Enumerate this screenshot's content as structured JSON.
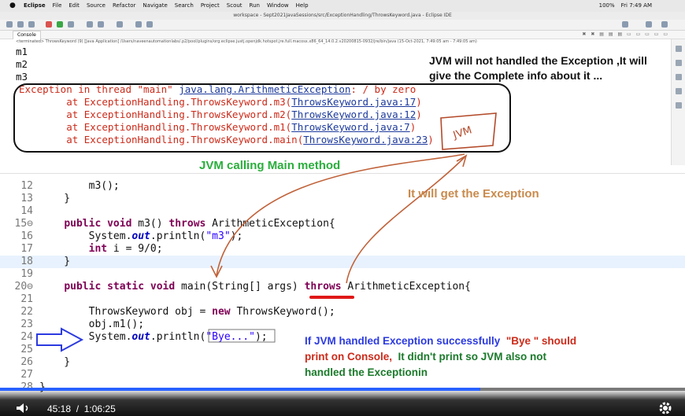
{
  "menubar": {
    "items": [
      "Eclipse",
      "File",
      "Edit",
      "Source",
      "Refactor",
      "Navigate",
      "Search",
      "Project",
      "Scout",
      "Run",
      "Window",
      "Help"
    ],
    "battery": "100%",
    "clock": "Fri 7:49 AM"
  },
  "window": {
    "title": "workspace - Sept2021JavaSessions/src/ExceptionHandling/ThrowsKeyword.java - Eclipse IDE"
  },
  "console": {
    "tab_label": "Console",
    "terminated_line": "<terminated> ThrowsKeyword (9) [Java Application] /Users/naveenautomationlabs/.p2/pool/plugins/org.eclipse.justj.openjdk.hotspot.jre.full.macosx.x86_64_14.0.2.v20200815-0932/jre/bin/java (15-Oct-2021, 7:49:05 am - 7:49:05 am)",
    "output": [
      "m1",
      "m2",
      "m3"
    ],
    "exception": {
      "prefix": "Exception in thread \"main\" ",
      "class": "java.lang.ArithmeticException",
      "suffix": ": / by zero"
    },
    "stack": [
      {
        "at": "        at ExceptionHandling.ThrowsKeyword.m3(",
        "link": "ThrowsKeyword.java:17",
        "end": ")"
      },
      {
        "at": "        at ExceptionHandling.ThrowsKeyword.m2(",
        "link": "ThrowsKeyword.java:12",
        "end": ")"
      },
      {
        "at": "        at ExceptionHandling.ThrowsKeyword.m1(",
        "link": "ThrowsKeyword.java:7",
        "end": ")"
      },
      {
        "at": "        at ExceptionHandling.ThrowsKeyword.main(",
        "link": "ThrowsKeyword.java:23",
        "end": ")"
      }
    ]
  },
  "editor": {
    "lines": [
      {
        "n": "12",
        "t": "        m3();"
      },
      {
        "n": "13",
        "t": "    }"
      },
      {
        "n": "14",
        "t": ""
      },
      {
        "n": "15⊖",
        "t": "    public void m3() throws ArithmeticException{"
      },
      {
        "n": "16",
        "t": "        System.out.println(\"m3\");"
      },
      {
        "n": "17",
        "t": "        int i = 9/0;"
      },
      {
        "n": "18",
        "t": "    }"
      },
      {
        "n": "19",
        "t": ""
      },
      {
        "n": "20⊖",
        "t": "    public static void main(String[] args) throws ArithmeticException{"
      },
      {
        "n": "21",
        "t": ""
      },
      {
        "n": "22",
        "t": "        ThrowsKeyword obj = new ThrowsKeyword();"
      },
      {
        "n": "23",
        "t": "        obj.m1();"
      },
      {
        "n": "24",
        "t": "        System.out.println(\"Bye...\");"
      },
      {
        "n": "25",
        "t": ""
      },
      {
        "n": "26",
        "t": "    }"
      },
      {
        "n": "27",
        "t": ""
      },
      {
        "n": "28",
        "t": "}"
      }
    ]
  },
  "annotations": {
    "jvm_not_handled_1": "JVM will not handled the Exception ,It will",
    "jvm_not_handled_2": "give the Complete info about it ...",
    "jvm_calling_main": "JVM calling Main method",
    "will_get_exception": "It will get the Exception",
    "handwritten": "JVM",
    "if_jvm_1a": "If JVM handled Exception successfully",
    "if_jvm_1b": "\"Bye \" should",
    "if_jvm_2a": "print on Console,",
    "if_jvm_2b": "It didn't print so JVM also not",
    "if_jvm_3": "handled the Exceptionin"
  },
  "player": {
    "current_time": "45:18",
    "separator": "/",
    "duration": "1:06:25",
    "progress_fraction": 0.701
  },
  "colors": {
    "error_red": "#cc2b1a",
    "link_blue": "#1d3a9c",
    "keyword_purple": "#7f0055",
    "annotation_green": "#2aae3c",
    "annotation_brown": "#c98a4c",
    "progress_blue": "#2962ff"
  }
}
